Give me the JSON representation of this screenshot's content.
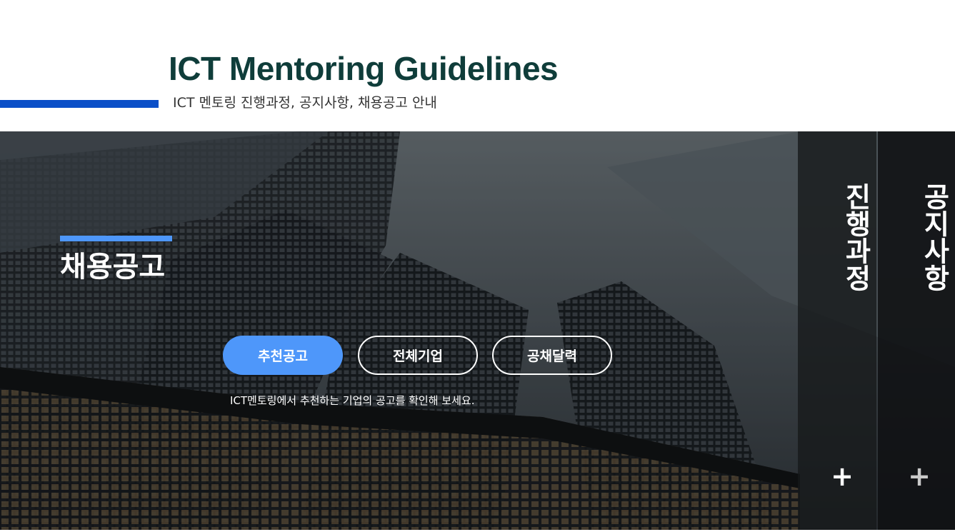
{
  "header": {
    "title": "ICT Mentoring Guidelines",
    "subtitle": "ICT 멘토링 진행과정, 공지사항, 채용공고 안내"
  },
  "hero": {
    "section_title": "채용공고",
    "buttons": [
      {
        "label": "추천공고",
        "active": true
      },
      {
        "label": "전체기업",
        "active": false
      },
      {
        "label": "공채달력",
        "active": false
      }
    ],
    "description": "ICT멘토링에서 추천하는 기업의 공고를 확인해 보세요."
  },
  "side_panels": [
    {
      "label": "진행과정",
      "icon": "plus-icon"
    },
    {
      "label": "공지사항",
      "icon": "plus-icon"
    }
  ],
  "colors": {
    "title": "#0f3d3a",
    "accent_blue": "#0a4fc8",
    "active_button": "#4e97fa",
    "section_bar": "#4e97fa"
  }
}
